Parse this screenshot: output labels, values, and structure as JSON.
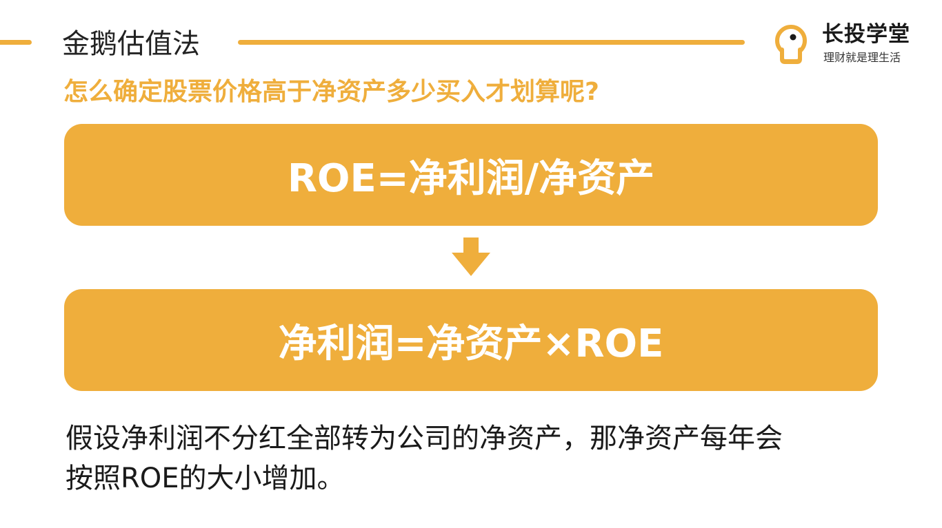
{
  "header": {
    "section_title": "金鹅估值法",
    "accent_color": "#EFAE3C"
  },
  "logo": {
    "icon": "lightbulb-icon",
    "name": "长投学堂",
    "slogan": "理财就是理生活"
  },
  "question": "怎么确定股票价格高于净资产多少买入才划算呢?",
  "formulas": [
    {
      "text": "ROE=净利润/净资产"
    },
    {
      "text": "净利润=净资产×ROE"
    }
  ],
  "arrow_icon": "arrow-down-icon",
  "body": {
    "line1": "假设净利润不分红全部转为公司的净资产，那净资产每年会",
    "line2": "按照ROE的大小增加。"
  }
}
